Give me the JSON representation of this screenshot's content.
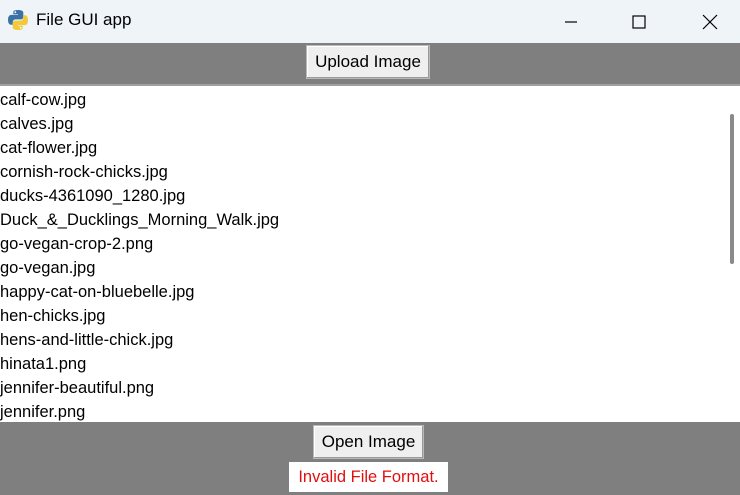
{
  "window": {
    "title": "File GUI app",
    "icon": "python-icon",
    "controls": [
      "minimize-icon",
      "maximize-icon",
      "close-icon"
    ]
  },
  "toolbar": {
    "upload_label": "Upload Image"
  },
  "file_list": {
    "items": [
      "calf-cow.jpg",
      "calves.jpg",
      "cat-flower.jpg",
      "cornish-rock-chicks.jpg",
      "ducks-4361090_1280.jpg",
      "Duck_&_Ducklings_Morning_Walk.jpg",
      "go-vegan-crop-2.png",
      "go-vegan.jpg",
      "happy-cat-on-bluebelle.jpg",
      "hen-chicks.jpg",
      "hens-and-little-chick.jpg",
      "hinata1.png",
      "jennifer-beautiful.png",
      "jennifer.png"
    ]
  },
  "footer": {
    "open_label": "Open Image",
    "status_text": "Invalid File Format.",
    "status_color": "#e01010"
  },
  "colors": {
    "background": "#7f7f7f",
    "titlebar": "#eff4f9"
  }
}
